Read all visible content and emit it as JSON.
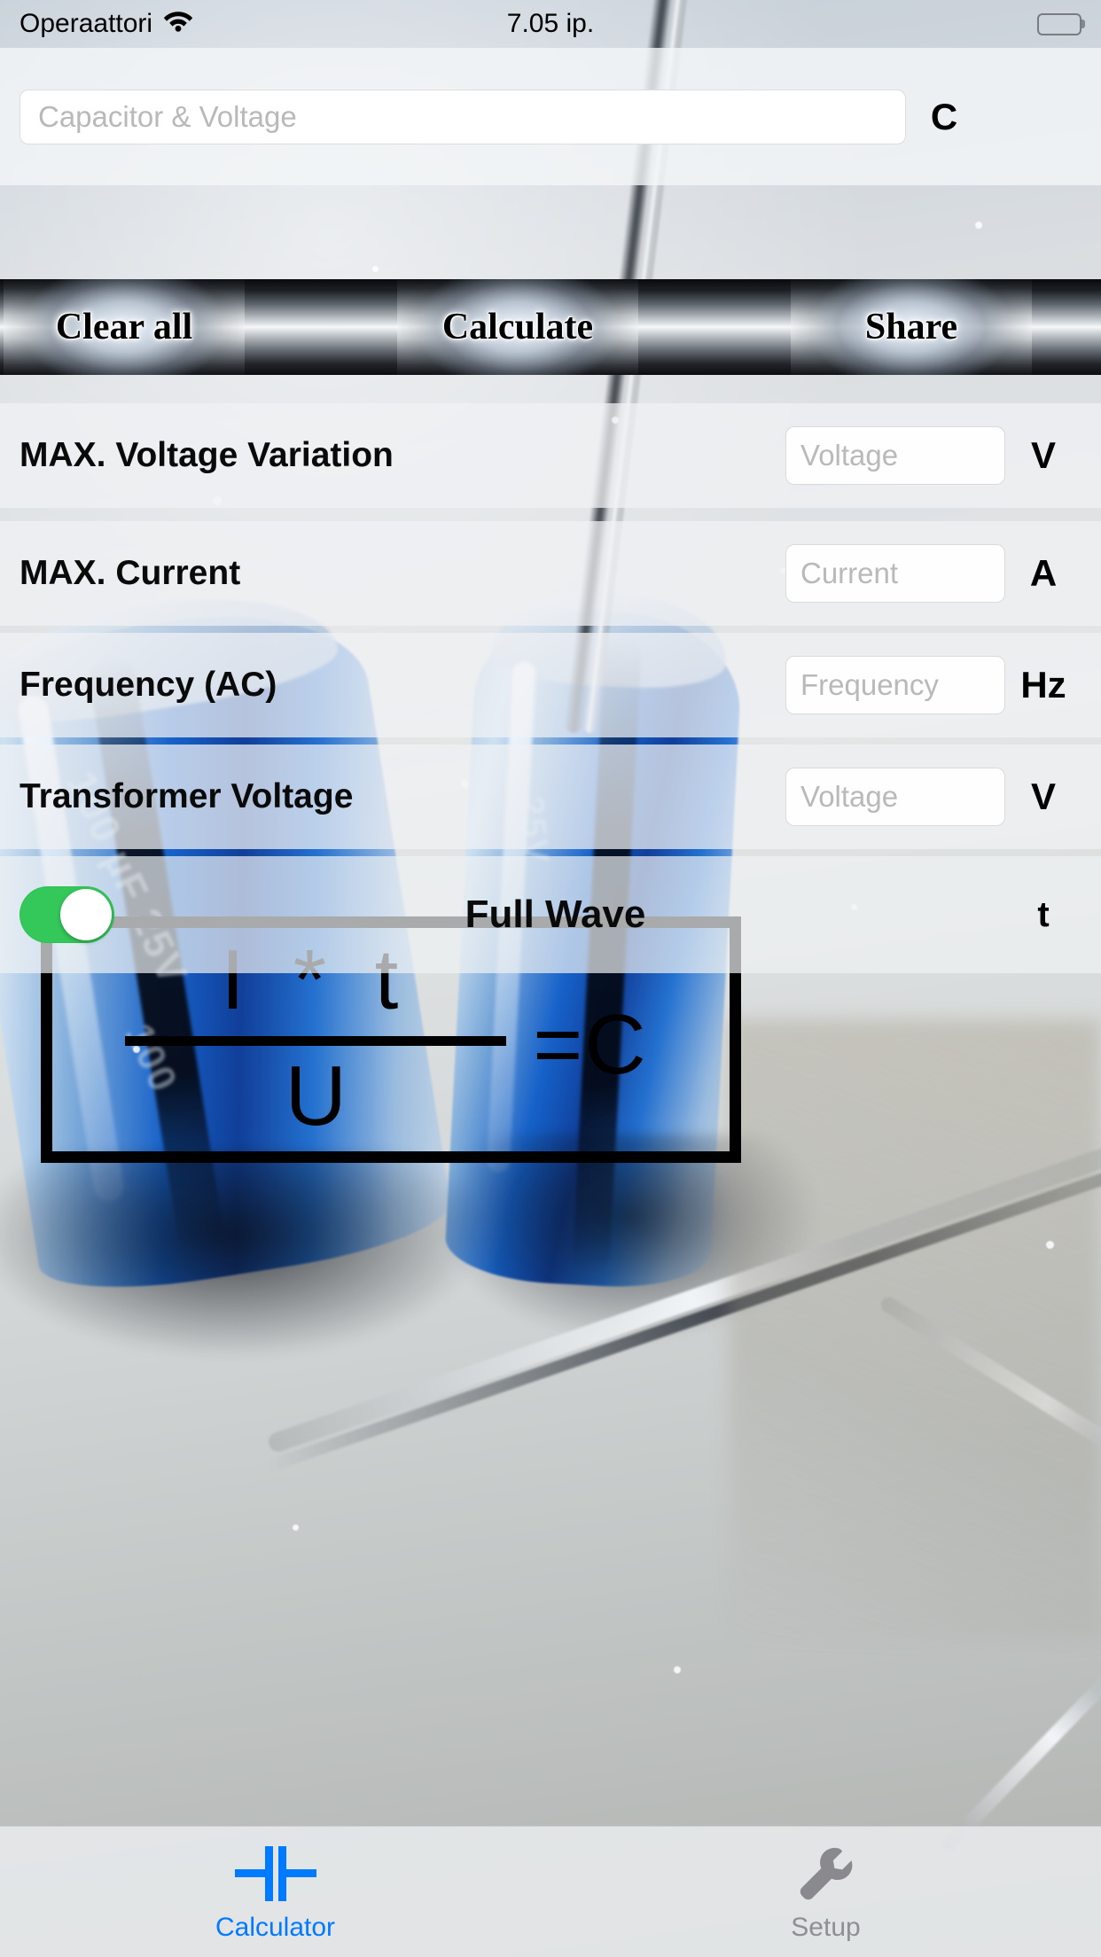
{
  "status_bar": {
    "carrier": "Operaattori",
    "wifi_icon": "wifi-icon",
    "time": "7.05 ip.",
    "battery_icon": "battery-full-icon"
  },
  "top_panel": {
    "capacitor_voltage": {
      "placeholder": "Capacitor & Voltage",
      "value": "",
      "unit": "C"
    }
  },
  "action_buttons": [
    {
      "label": "Clear all"
    },
    {
      "label": "Calculate"
    },
    {
      "label": "Share"
    }
  ],
  "form_rows": [
    {
      "label": "MAX. Voltage Variation",
      "placeholder": "Voltage",
      "value": "",
      "unit": "V"
    },
    {
      "label": "MAX. Current",
      "placeholder": "Current",
      "value": "",
      "unit": "A"
    },
    {
      "label": "Frequency (AC)",
      "placeholder": "Frequency",
      "value": "",
      "unit": "Hz"
    },
    {
      "label": "Transformer Voltage",
      "placeholder": "Voltage",
      "value": "",
      "unit": "V"
    }
  ],
  "toggle_row": {
    "label": "Full Wave",
    "unit": "t",
    "state": "on"
  },
  "formula": {
    "numerator": "I * t",
    "denominator": "U",
    "result": "=C"
  },
  "tab_bar": [
    {
      "label": "Calculator",
      "icon": "capacitor-icon",
      "active": true
    },
    {
      "label": "Setup",
      "icon": "wrench-icon",
      "active": false
    }
  ],
  "colors": {
    "accent_blue": "#007aff",
    "inactive_gray": "#8e8e93",
    "switch_on_green": "#34c759"
  }
}
